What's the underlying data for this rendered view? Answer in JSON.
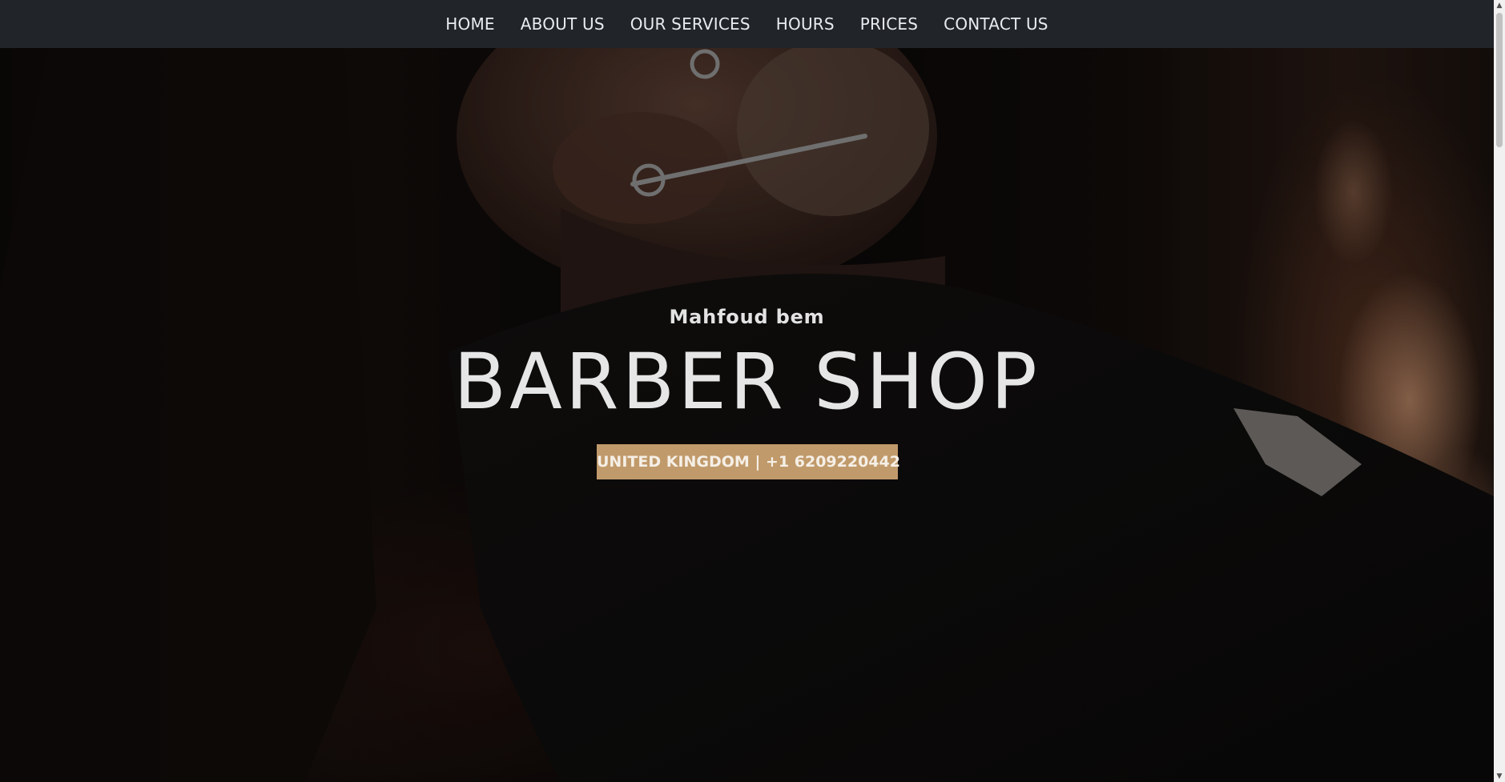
{
  "nav": {
    "items": [
      {
        "label": "HOME"
      },
      {
        "label": "ABOUT US"
      },
      {
        "label": "OUR SERVICES"
      },
      {
        "label": "HOURS"
      },
      {
        "label": "PRICES"
      },
      {
        "label": "CONTACT US"
      }
    ]
  },
  "hero": {
    "subtitle": "Mahfoud bem",
    "title": "BARBER SHOP",
    "badge": "UNITED KINGDOM | +1 6209220442"
  },
  "colors": {
    "nav_background": "#212429",
    "accent": "#c19a6b",
    "hero_text": "#e6e6e6"
  },
  "icons": {
    "scroll_up": "scroll-up-arrow-icon",
    "scroll_down": "scroll-down-arrow-icon"
  }
}
